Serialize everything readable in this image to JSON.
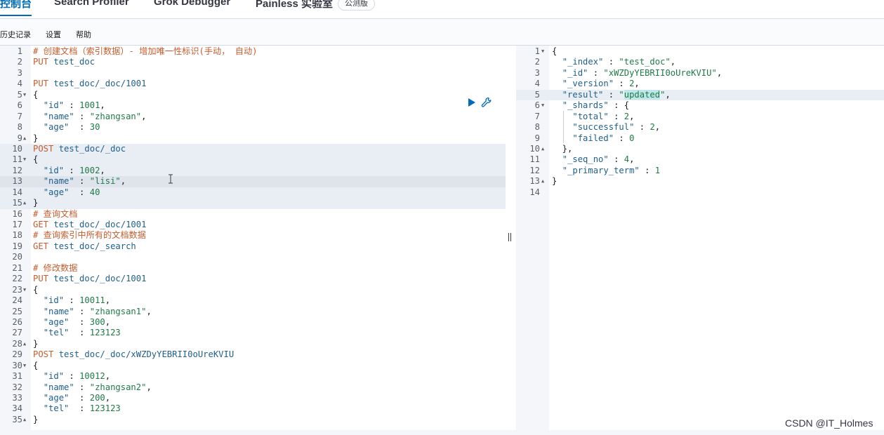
{
  "tabs": [
    {
      "label": "控制台"
    },
    {
      "label": "Search Profiler"
    },
    {
      "label": "Grok Debugger"
    },
    {
      "label": "Painless 实验室"
    }
  ],
  "beta_badge": "公测版",
  "subnav": {
    "history": "历史记录",
    "settings": "设置",
    "help": "帮助"
  },
  "left_editor": {
    "lines": [
      "# 创建文档（索引数据）- 增加唯一性标识(手动， 自动)",
      "PUT test_doc",
      "",
      "PUT test_doc/_doc/1001",
      "{",
      "  \"id\" : 1001,",
      "  \"name\" : \"zhangsan\",",
      "  \"age\"  : 30",
      "}",
      "POST test_doc/_doc",
      "{",
      "  \"id\" : 1002,",
      "  \"name\" : \"lisi\",",
      "  \"age\"  : 40",
      "}",
      "# 查询文档",
      "GET test_doc/_doc/1001",
      "# 查询索引中所有的文档数据",
      "GET test_doc/_search",
      "",
      "# 修改数据",
      "PUT test_doc/_doc/1001",
      "{",
      "  \"id\" : 10011,",
      "  \"name\" : \"zhangsan1\",",
      "  \"age\"  : 300,",
      "  \"tel\"  : 123123",
      "}",
      "POST test_doc/_doc/xWZDyYEBRII0oUreKVIU",
      "{",
      "  \"id\" : 10012,",
      "  \"name\" : \"zhangsan2\",",
      "  \"age\"  : 200,",
      "  \"tel\"  : 123123",
      "}"
    ]
  },
  "right_editor": {
    "lines": [
      "{",
      "  \"_index\" : \"test_doc\",",
      "  \"_id\" : \"xWZDyYEBRII0oUreKVIU\",",
      "  \"_version\" : 2,",
      "  \"result\" : \"updated\",",
      "  \"_shards\" : {",
      "    \"total\" : 2,",
      "    \"successful\" : 2,",
      "    \"failed\" : 0",
      "  },",
      "  \"_seq_no\" : 4,",
      "  \"_primary_term\" : 1",
      "}",
      ""
    ]
  },
  "watermark": "CSDN @IT_Holmes",
  "colors": {
    "accent": "#006bb8",
    "method": "#c65d2e",
    "string": "#1f7a45",
    "key": "#1e5f8c"
  }
}
